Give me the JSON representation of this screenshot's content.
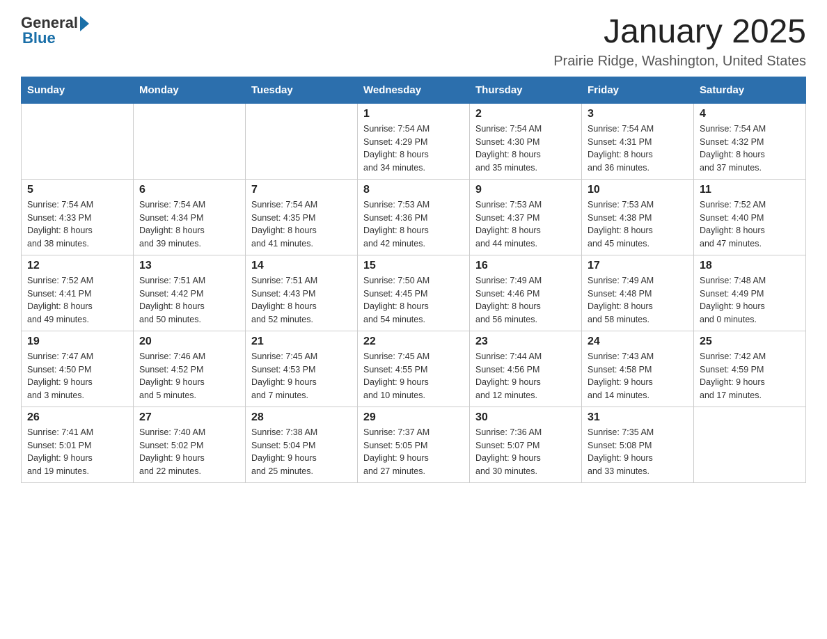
{
  "header": {
    "logo": {
      "general": "General",
      "triangle": "▶",
      "blue": "Blue"
    },
    "month_title": "January 2025",
    "location": "Prairie Ridge, Washington, United States"
  },
  "days_of_week": [
    "Sunday",
    "Monday",
    "Tuesday",
    "Wednesday",
    "Thursday",
    "Friday",
    "Saturday"
  ],
  "weeks": [
    {
      "days": [
        {
          "number": "",
          "info": ""
        },
        {
          "number": "",
          "info": ""
        },
        {
          "number": "",
          "info": ""
        },
        {
          "number": "1",
          "info": "Sunrise: 7:54 AM\nSunset: 4:29 PM\nDaylight: 8 hours\nand 34 minutes."
        },
        {
          "number": "2",
          "info": "Sunrise: 7:54 AM\nSunset: 4:30 PM\nDaylight: 8 hours\nand 35 minutes."
        },
        {
          "number": "3",
          "info": "Sunrise: 7:54 AM\nSunset: 4:31 PM\nDaylight: 8 hours\nand 36 minutes."
        },
        {
          "number": "4",
          "info": "Sunrise: 7:54 AM\nSunset: 4:32 PM\nDaylight: 8 hours\nand 37 minutes."
        }
      ]
    },
    {
      "days": [
        {
          "number": "5",
          "info": "Sunrise: 7:54 AM\nSunset: 4:33 PM\nDaylight: 8 hours\nand 38 minutes."
        },
        {
          "number": "6",
          "info": "Sunrise: 7:54 AM\nSunset: 4:34 PM\nDaylight: 8 hours\nand 39 minutes."
        },
        {
          "number": "7",
          "info": "Sunrise: 7:54 AM\nSunset: 4:35 PM\nDaylight: 8 hours\nand 41 minutes."
        },
        {
          "number": "8",
          "info": "Sunrise: 7:53 AM\nSunset: 4:36 PM\nDaylight: 8 hours\nand 42 minutes."
        },
        {
          "number": "9",
          "info": "Sunrise: 7:53 AM\nSunset: 4:37 PM\nDaylight: 8 hours\nand 44 minutes."
        },
        {
          "number": "10",
          "info": "Sunrise: 7:53 AM\nSunset: 4:38 PM\nDaylight: 8 hours\nand 45 minutes."
        },
        {
          "number": "11",
          "info": "Sunrise: 7:52 AM\nSunset: 4:40 PM\nDaylight: 8 hours\nand 47 minutes."
        }
      ]
    },
    {
      "days": [
        {
          "number": "12",
          "info": "Sunrise: 7:52 AM\nSunset: 4:41 PM\nDaylight: 8 hours\nand 49 minutes."
        },
        {
          "number": "13",
          "info": "Sunrise: 7:51 AM\nSunset: 4:42 PM\nDaylight: 8 hours\nand 50 minutes."
        },
        {
          "number": "14",
          "info": "Sunrise: 7:51 AM\nSunset: 4:43 PM\nDaylight: 8 hours\nand 52 minutes."
        },
        {
          "number": "15",
          "info": "Sunrise: 7:50 AM\nSunset: 4:45 PM\nDaylight: 8 hours\nand 54 minutes."
        },
        {
          "number": "16",
          "info": "Sunrise: 7:49 AM\nSunset: 4:46 PM\nDaylight: 8 hours\nand 56 minutes."
        },
        {
          "number": "17",
          "info": "Sunrise: 7:49 AM\nSunset: 4:48 PM\nDaylight: 8 hours\nand 58 minutes."
        },
        {
          "number": "18",
          "info": "Sunrise: 7:48 AM\nSunset: 4:49 PM\nDaylight: 9 hours\nand 0 minutes."
        }
      ]
    },
    {
      "days": [
        {
          "number": "19",
          "info": "Sunrise: 7:47 AM\nSunset: 4:50 PM\nDaylight: 9 hours\nand 3 minutes."
        },
        {
          "number": "20",
          "info": "Sunrise: 7:46 AM\nSunset: 4:52 PM\nDaylight: 9 hours\nand 5 minutes."
        },
        {
          "number": "21",
          "info": "Sunrise: 7:45 AM\nSunset: 4:53 PM\nDaylight: 9 hours\nand 7 minutes."
        },
        {
          "number": "22",
          "info": "Sunrise: 7:45 AM\nSunset: 4:55 PM\nDaylight: 9 hours\nand 10 minutes."
        },
        {
          "number": "23",
          "info": "Sunrise: 7:44 AM\nSunset: 4:56 PM\nDaylight: 9 hours\nand 12 minutes."
        },
        {
          "number": "24",
          "info": "Sunrise: 7:43 AM\nSunset: 4:58 PM\nDaylight: 9 hours\nand 14 minutes."
        },
        {
          "number": "25",
          "info": "Sunrise: 7:42 AM\nSunset: 4:59 PM\nDaylight: 9 hours\nand 17 minutes."
        }
      ]
    },
    {
      "days": [
        {
          "number": "26",
          "info": "Sunrise: 7:41 AM\nSunset: 5:01 PM\nDaylight: 9 hours\nand 19 minutes."
        },
        {
          "number": "27",
          "info": "Sunrise: 7:40 AM\nSunset: 5:02 PM\nDaylight: 9 hours\nand 22 minutes."
        },
        {
          "number": "28",
          "info": "Sunrise: 7:38 AM\nSunset: 5:04 PM\nDaylight: 9 hours\nand 25 minutes."
        },
        {
          "number": "29",
          "info": "Sunrise: 7:37 AM\nSunset: 5:05 PM\nDaylight: 9 hours\nand 27 minutes."
        },
        {
          "number": "30",
          "info": "Sunrise: 7:36 AM\nSunset: 5:07 PM\nDaylight: 9 hours\nand 30 minutes."
        },
        {
          "number": "31",
          "info": "Sunrise: 7:35 AM\nSunset: 5:08 PM\nDaylight: 9 hours\nand 33 minutes."
        },
        {
          "number": "",
          "info": ""
        }
      ]
    }
  ]
}
